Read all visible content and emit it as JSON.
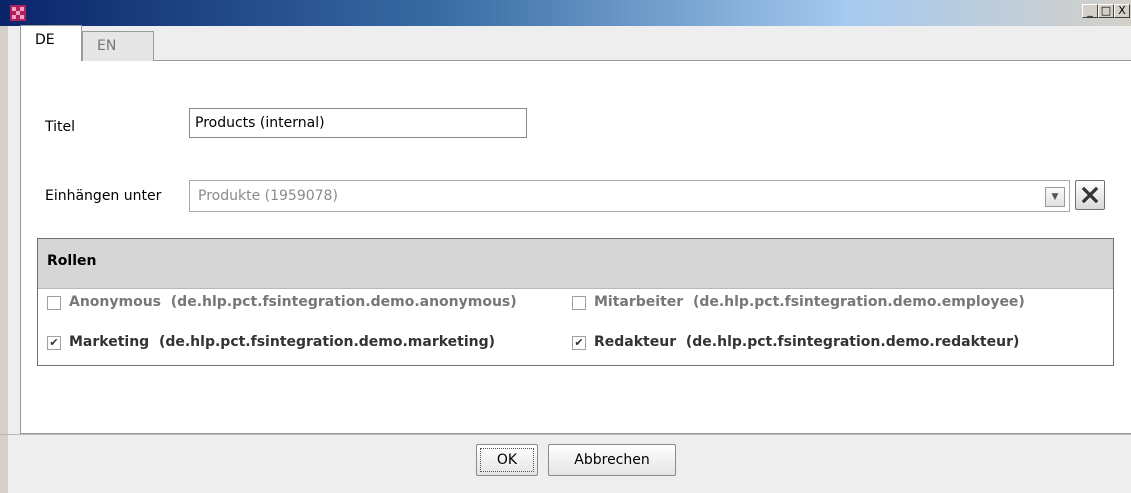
{
  "window": {
    "icon": "app-icon",
    "controls": {
      "minimize": "_",
      "maximize": "□",
      "close": "X"
    }
  },
  "tabs": [
    {
      "label": "DE",
      "active": true
    },
    {
      "label": "EN",
      "active": false
    }
  ],
  "form": {
    "titel_label": "Titel",
    "titel_value": "Products (internal)",
    "einhaengen_label": "Einhängen unter",
    "einhaengen_value": "Produkte  (1959078)"
  },
  "rollen": {
    "header": "Rollen",
    "items": [
      {
        "name": "Anonymous",
        "id": "(de.hlp.pct.fsintegration.demo.anonymous)",
        "checked": false,
        "mark": ""
      },
      {
        "name": "Mitarbeiter",
        "id": "(de.hlp.pct.fsintegration.demo.employee)",
        "checked": false,
        "mark": ""
      },
      {
        "name": "Marketing",
        "id": "(de.hlp.pct.fsintegration.demo.marketing)",
        "checked": true,
        "mark": "✔"
      },
      {
        "name": "Redakteur",
        "id": "(de.hlp.pct.fsintegration.demo.redakteur)",
        "checked": true,
        "mark": "✔"
      }
    ]
  },
  "buttons": {
    "ok": "OK",
    "cancel": "Abbrechen"
  },
  "colors": {
    "titlebar_start": "#0a246a",
    "background": "#eeeeee",
    "panel": "#ffffff",
    "section_header": "#d6d6d6"
  }
}
